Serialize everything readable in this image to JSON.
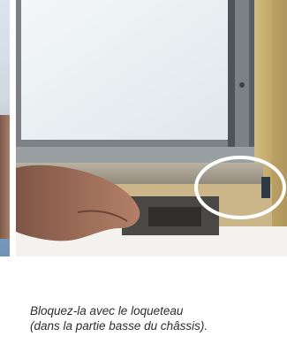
{
  "caption": {
    "line1": "Bloquez-la avec le loqueteau",
    "line2": "(dans la partie basse du châssis)."
  },
  "colors": {
    "glass": "#e7eef2",
    "frame_gray": "#6a6a6a",
    "wood": "#c8b07a",
    "highlight_ring": "#ffffff",
    "caption_text": "#2d2d2d"
  },
  "icons": {
    "highlight_marker": "highlight-ring-icon"
  }
}
